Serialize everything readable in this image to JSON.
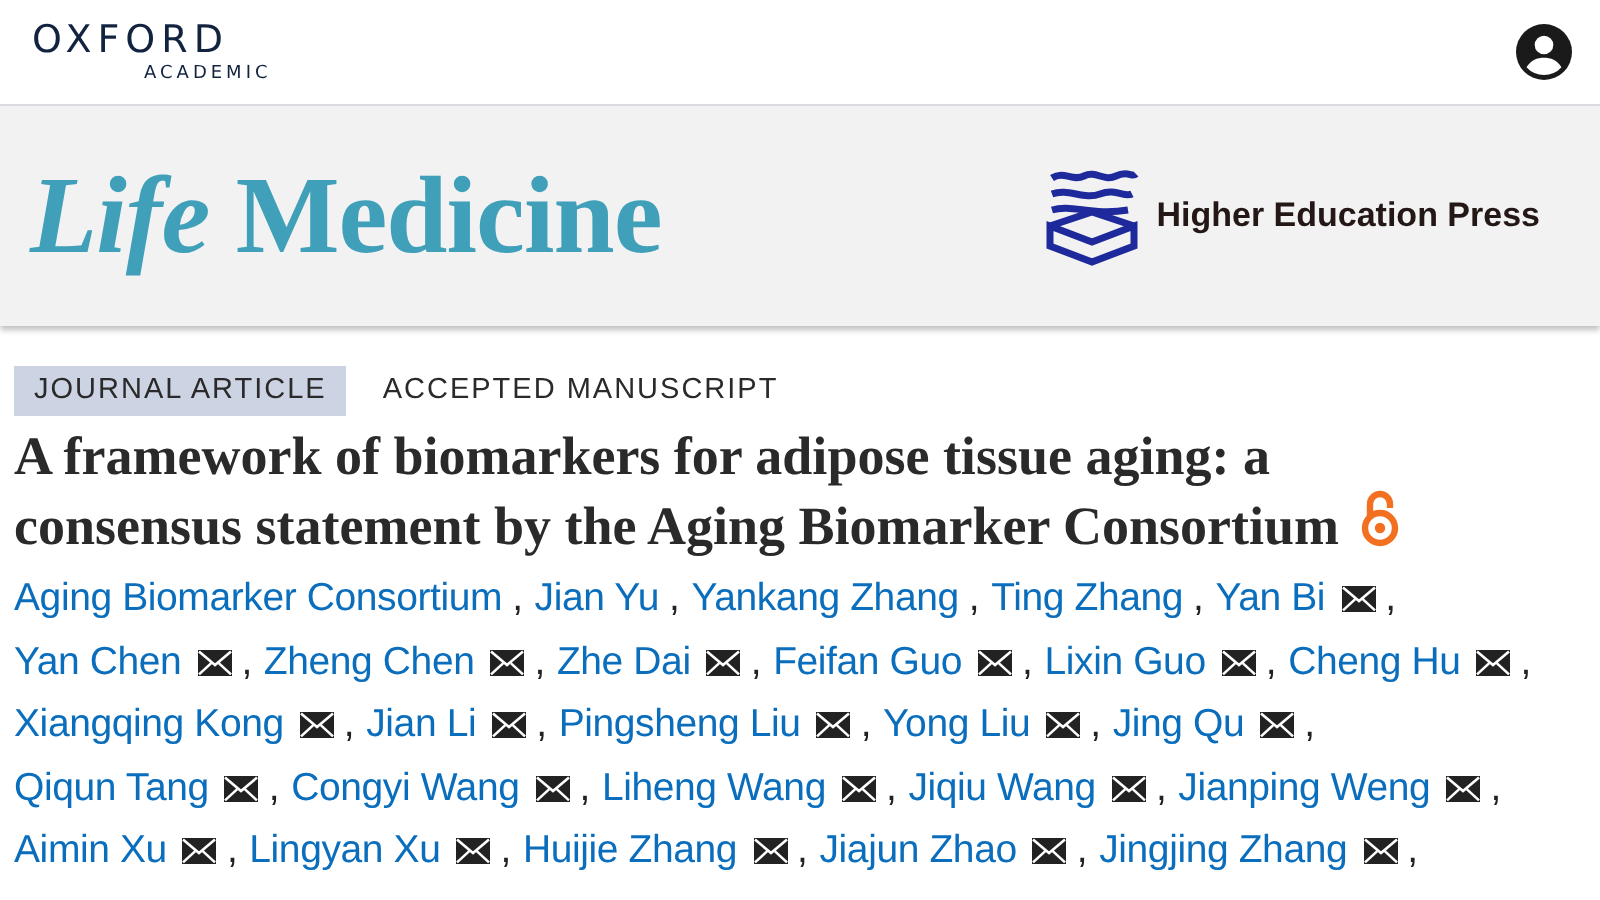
{
  "header": {
    "brand": "OXFORD",
    "brand_sub": "ACADEMIC"
  },
  "journal": {
    "title": "*Life* Medicine",
    "publisher": "Higher Education Press"
  },
  "article": {
    "tags": [
      {
        "label": "JOURNAL ARTICLE",
        "kind": "filled"
      },
      {
        "label": "ACCEPTED MANUSCRIPT",
        "kind": "plain"
      }
    ],
    "title": "A framework of biomarkers for adipose tissue aging: a consensus statement by the Aging Biomarker Consortium",
    "open_access": true,
    "author_lines": [
      [
        {
          "name": "Aging Biomarker Consortium",
          "email": false,
          "separator": ","
        },
        {
          "name": "Jian Yu",
          "email": false,
          "separator": ","
        },
        {
          "name": "Yankang Zhang",
          "email": false,
          "separator": ","
        },
        {
          "name": "Ting Zhang",
          "email": false,
          "separator": ","
        },
        {
          "name": "Yan Bi",
          "email": true,
          "separator": ","
        }
      ],
      [
        {
          "name": "Yan Chen",
          "email": true,
          "separator": ","
        },
        {
          "name": "Zheng Chen",
          "email": true,
          "separator": ","
        },
        {
          "name": "Zhe Dai",
          "email": true,
          "separator": ","
        },
        {
          "name": "Feifan Guo",
          "email": true,
          "separator": ","
        },
        {
          "name": "Lixin Guo",
          "email": true,
          "separator": ","
        },
        {
          "name": "Cheng Hu",
          "email": true,
          "separator": ","
        }
      ],
      [
        {
          "name": "Xiangqing Kong",
          "email": true,
          "separator": ","
        },
        {
          "name": "Jian Li",
          "email": true,
          "separator": ","
        },
        {
          "name": "Pingsheng Liu",
          "email": true,
          "separator": ","
        },
        {
          "name": "Yong Liu",
          "email": true,
          "separator": ","
        },
        {
          "name": "Jing Qu",
          "email": true,
          "separator": ","
        }
      ],
      [
        {
          "name": "Qiqun Tang",
          "email": true,
          "separator": ","
        },
        {
          "name": "Congyi Wang",
          "email": true,
          "separator": ","
        },
        {
          "name": "Liheng Wang",
          "email": true,
          "separator": ","
        },
        {
          "name": "Jiqiu Wang",
          "email": true,
          "separator": ","
        },
        {
          "name": "Jianping Weng",
          "email": true,
          "separator": ","
        }
      ],
      [
        {
          "name": "Aimin Xu",
          "email": true,
          "separator": ","
        },
        {
          "name": "Lingyan Xu",
          "email": true,
          "separator": ","
        },
        {
          "name": "Huijie Zhang",
          "email": true,
          "separator": ","
        },
        {
          "name": "Jiajun Zhao",
          "email": true,
          "separator": ","
        },
        {
          "name": "Jingjing Zhang",
          "email": true,
          "separator": ","
        }
      ]
    ]
  }
}
